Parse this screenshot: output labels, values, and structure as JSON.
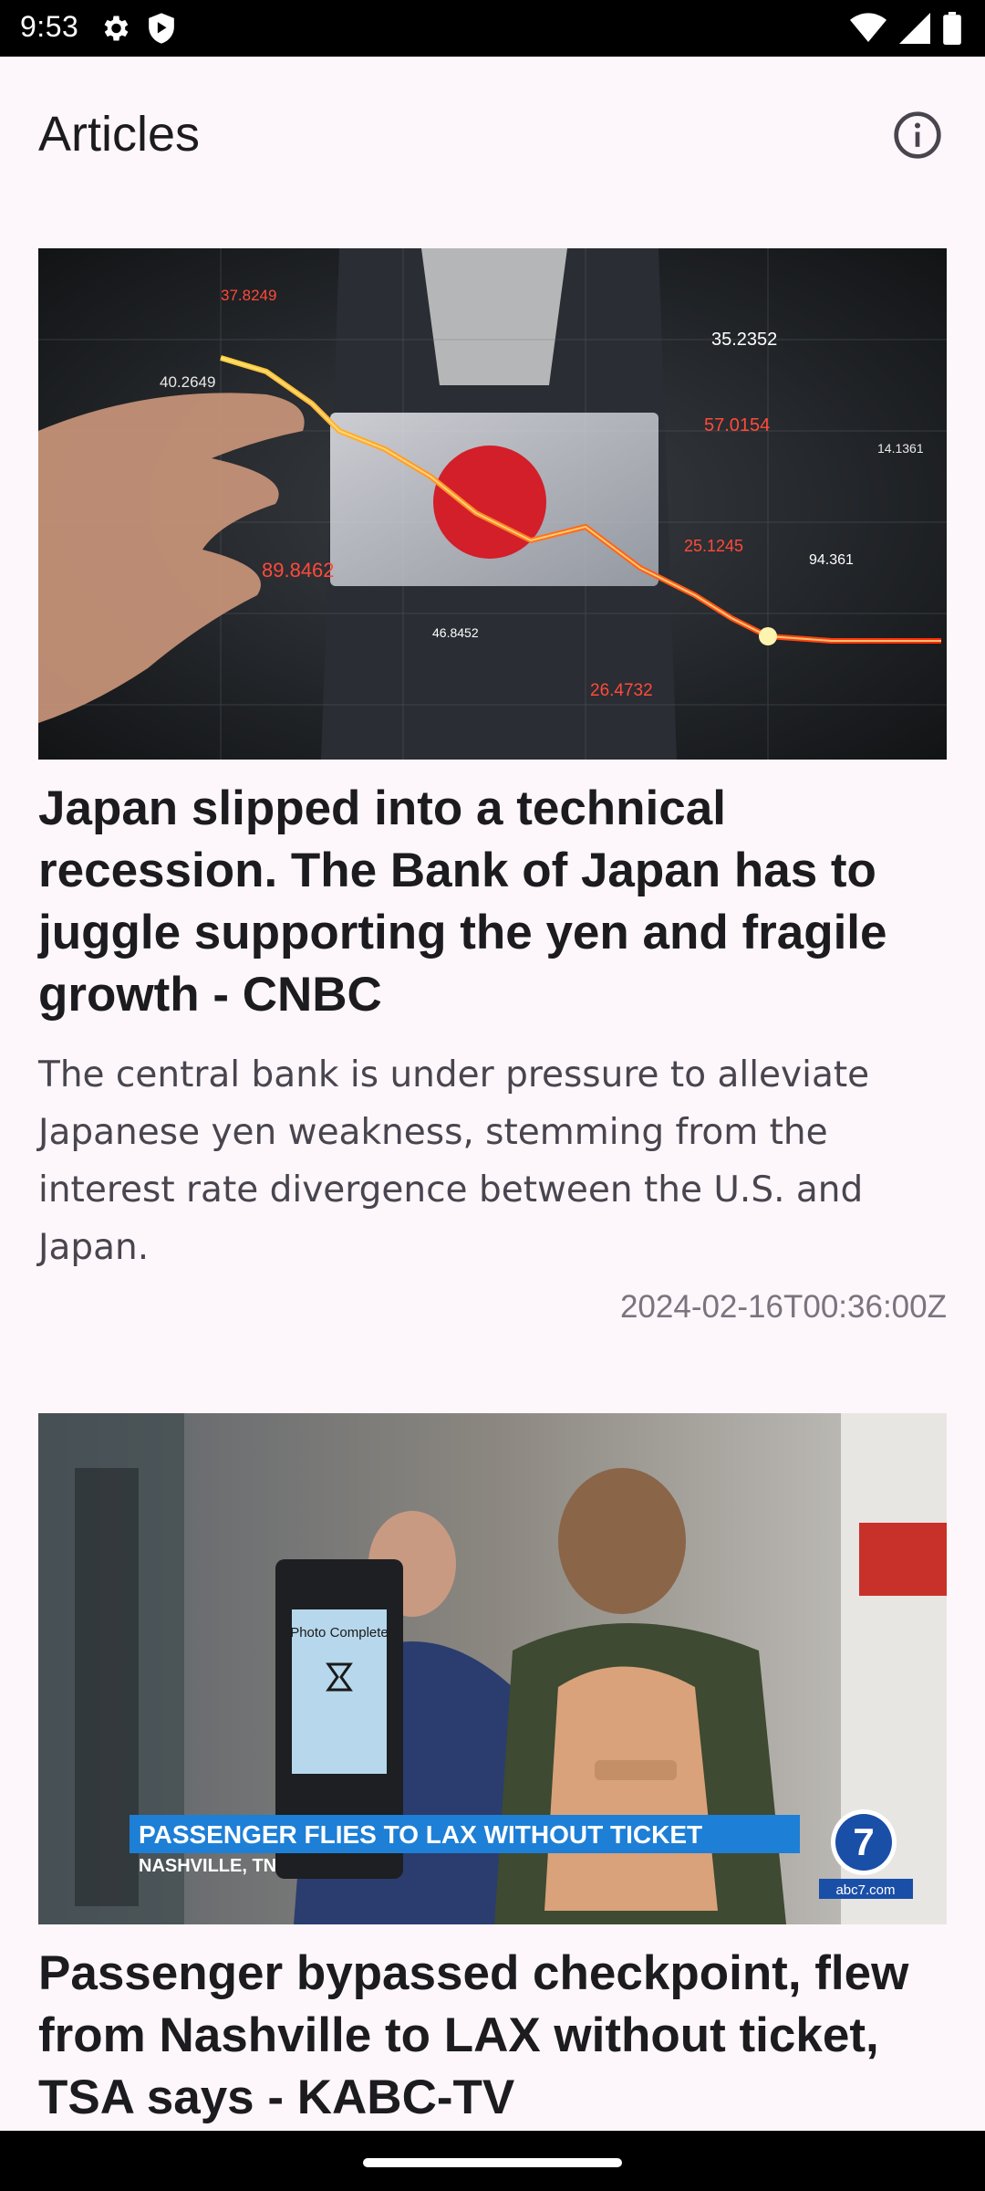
{
  "status_bar": {
    "time": "9:53",
    "icons_left": [
      "gear-icon",
      "shield-icon"
    ],
    "icons_right": [
      "wifi-icon",
      "signal-icon",
      "battery-icon"
    ]
  },
  "app_bar": {
    "title": "Articles",
    "action_icon": "info-icon"
  },
  "articles": [
    {
      "image_caption": "",
      "title": "Japan slipped into a technical recession. The Bank of Japan has to juggle supporting the yen and fragile growth - CNBC",
      "description": "The central bank is under pressure to alleviate Japanese yen weakness, stemming from the interest rate divergence between the U.S. and Japan.",
      "published": "2024-02-16T00:36:00Z",
      "image_numbers": [
        "37.8249",
        "40.2649",
        "89.8462",
        "35.2352",
        "57.0154",
        "14.1361",
        "25.1245",
        "94.361",
        "46.8452",
        "26.4732"
      ]
    },
    {
      "title": "Passenger bypassed checkpoint, flew from Nashville to LAX without ticket, TSA says - KABC-TV",
      "image_banner": "PASSENGER FLIES TO LAX WITHOUT TICKET",
      "image_location": "NASHVILLE, TN",
      "image_kiosk_title": "Photo Complete",
      "image_brand": "abc7.com"
    }
  ],
  "colors": {
    "background": "#fdf7fb",
    "title_text": "#1c1b1f",
    "body_text": "#49454f",
    "date_text": "#79747e",
    "status_bar": "#000000"
  }
}
